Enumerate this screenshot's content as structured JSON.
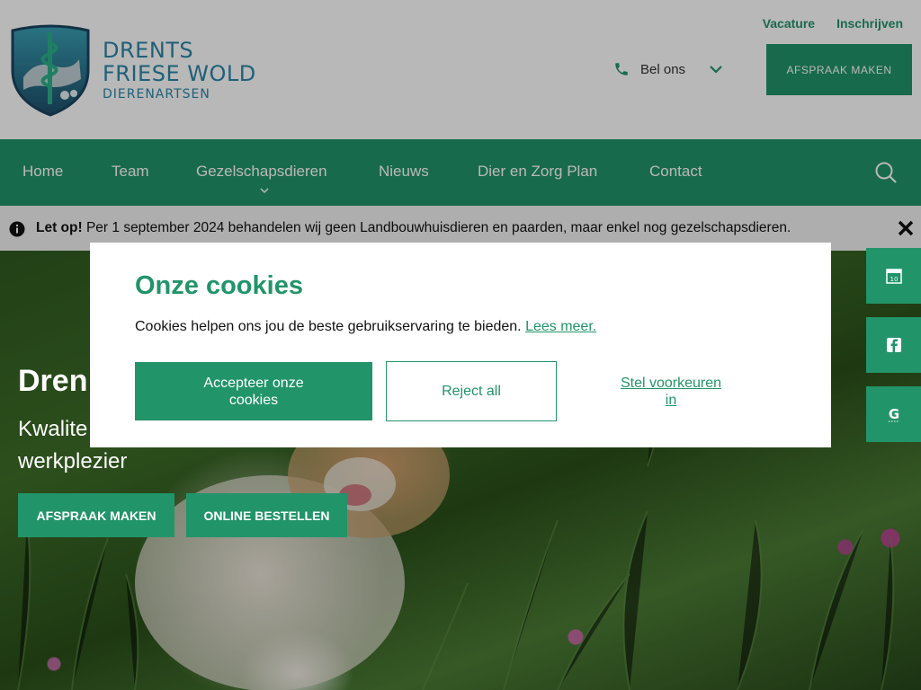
{
  "logo": {
    "line1": "DRENTS",
    "line2": "FRIESE WOLD",
    "line3": "DIERENARTSEN"
  },
  "toplinks": {
    "vacature": "Vacature",
    "inschrijven": "Inschrijven"
  },
  "contact": {
    "bel_label": "Bel ons"
  },
  "header": {
    "afspraak_label": "AFSPRAAK MAKEN"
  },
  "nav": {
    "items": [
      {
        "label": "Home"
      },
      {
        "label": "Team"
      },
      {
        "label": "Gezelschapsdieren"
      },
      {
        "label": "Nieuws"
      },
      {
        "label": "Dier en Zorg Plan"
      },
      {
        "label": "Contact"
      }
    ]
  },
  "notice": {
    "bold": "Let op!",
    "text": " Per 1 september 2024 behandelen wij geen Landbouwhuisdieren en paarden, maar enkel nog gezelschapsdieren."
  },
  "hero": {
    "title": "Dren",
    "subtitle": "Kwalite\nwerkplezier",
    "subtitle_line1": "Kwalite",
    "subtitle_line2": "werkplezier",
    "btn_afspraak": "AFSPRAAK MAKEN",
    "btn_bestellen": "ONLINE BESTELLEN"
  },
  "side_buttons": [
    {
      "icon": "calendar-icon",
      "text": "10"
    },
    {
      "icon": "facebook-icon"
    },
    {
      "icon": "google-icon",
      "text": "G"
    }
  ],
  "cookies": {
    "title": "Onze cookies",
    "message": "Cookies helpen ons jou de beste gebruikservaring te bieden. ",
    "link": "Lees meer.",
    "accept": "Accepteer onze cookies",
    "reject": "Reject all",
    "preferences": "Stel voorkeuren in"
  },
  "colors": {
    "brand_green": "#22946a",
    "logo_blue": "#2b86a8",
    "notice_bg": "#f1f1f1"
  }
}
